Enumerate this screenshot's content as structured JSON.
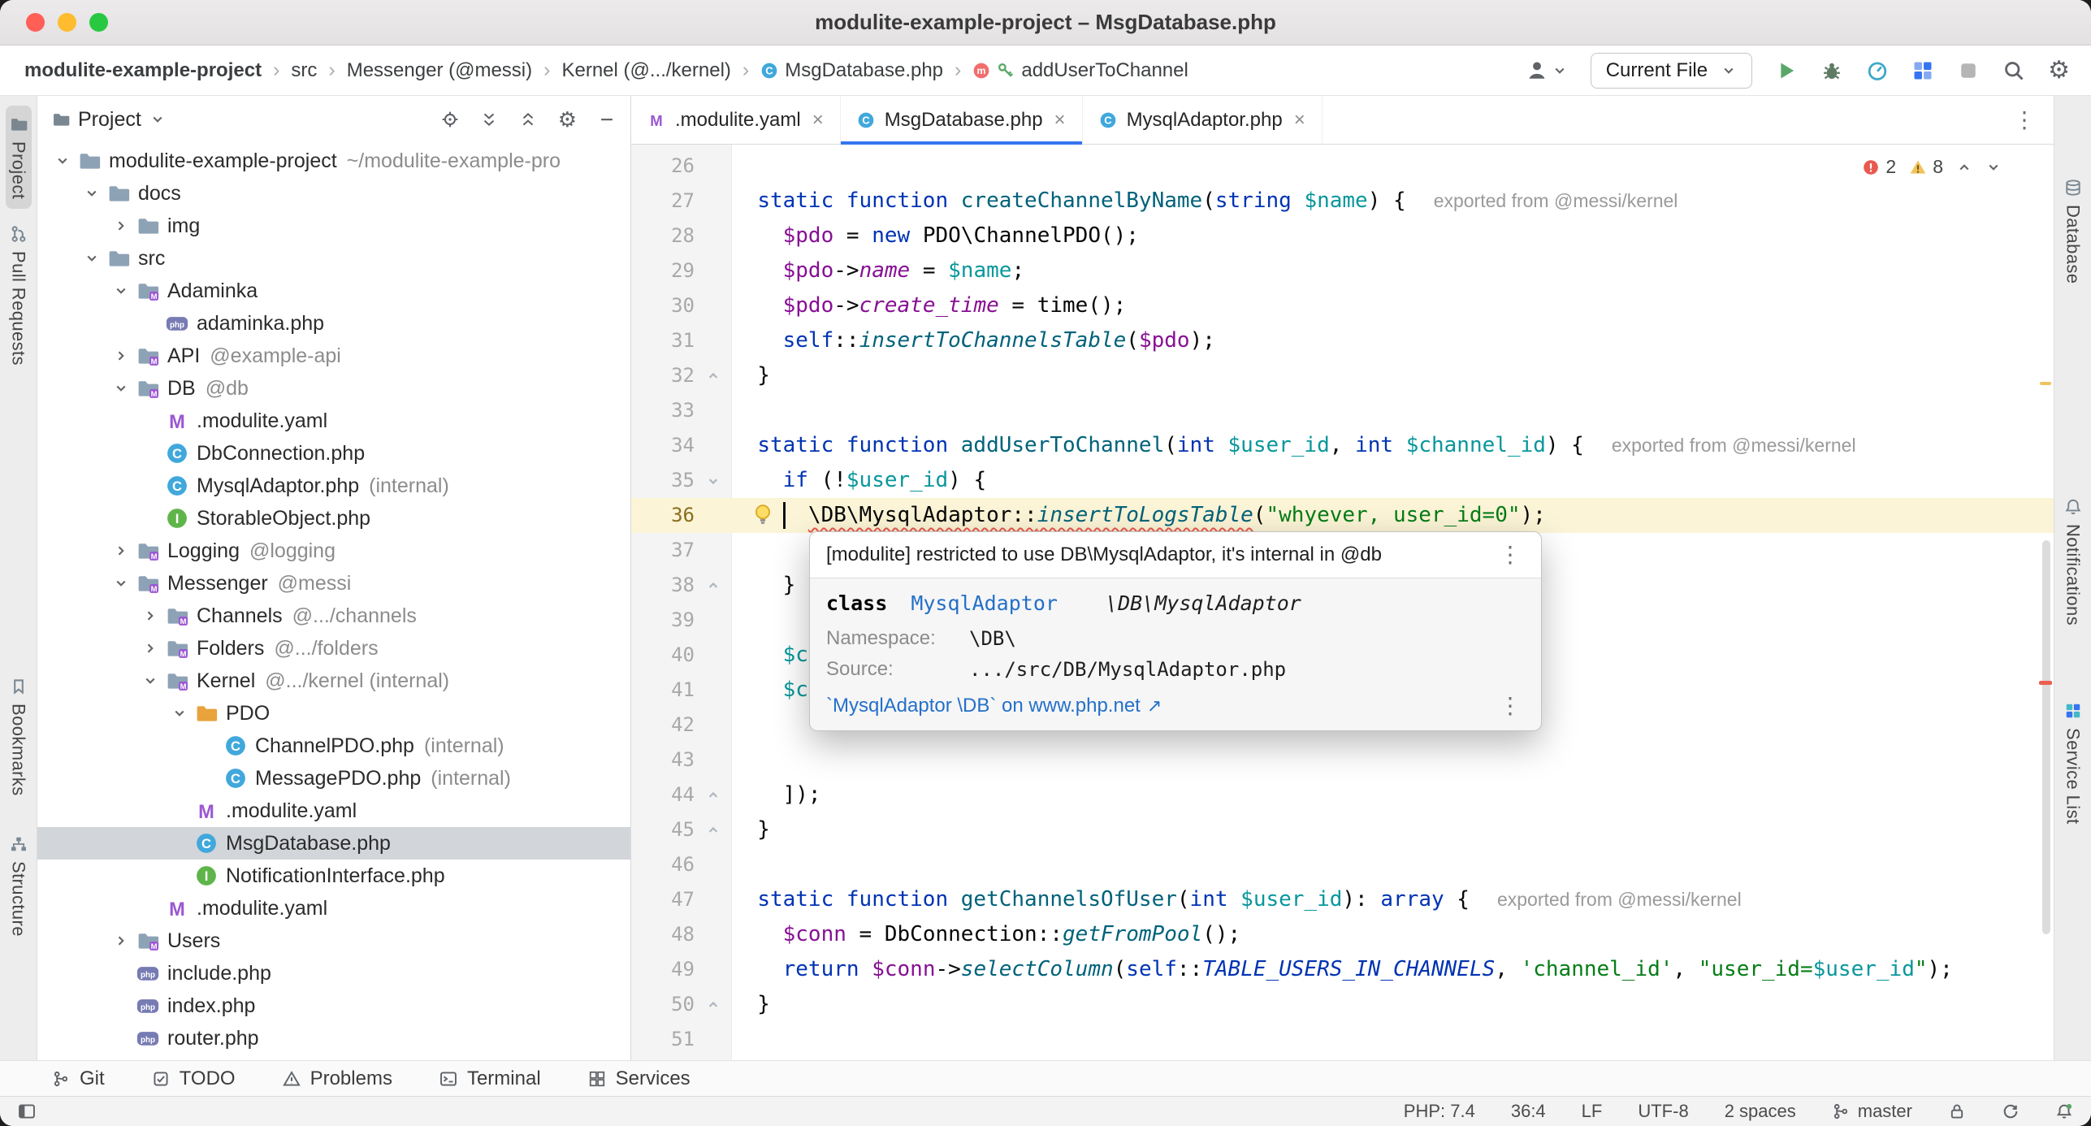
{
  "window": {
    "title": "modulite-example-project – MsgDatabase.php"
  },
  "colors": {
    "accent": "#3574F0",
    "error": "#E8594F",
    "warning": "#F2C35C",
    "keyword": "#0033B3",
    "string": "#067D17",
    "variable": "#871094",
    "parameter": "#08979C",
    "function": "#00627A",
    "selection": "#D2D5D9",
    "line_highlight": "#FCF4D6"
  },
  "navbar": {
    "breadcrumbs": [
      {
        "label": "modulite-example-project",
        "bold": true
      },
      {
        "label": "src"
      },
      {
        "label": "Messenger (@messi)"
      },
      {
        "label": "Kernel (@.../kernel)"
      },
      {
        "label": "MsgDatabase.php",
        "icons": [
          "class"
        ]
      },
      {
        "label": "addUserToChannel",
        "icons": [
          "method",
          "key"
        ]
      }
    ],
    "run_config": "Current File"
  },
  "left_stripe": [
    {
      "label": "Project",
      "icon": "project",
      "active": true,
      "gap": 12
    },
    {
      "label": "Pull Requests",
      "icon": "pull-request",
      "gap": 8
    },
    {
      "label": "Bookmarks",
      "icon": "bookmark",
      "gap": 360
    },
    {
      "label": "Structure",
      "icon": "structure",
      "gap": 24
    }
  ],
  "right_stripe": [
    {
      "label": "Database",
      "icon": "database",
      "gap": 90
    },
    {
      "label": "Notifications",
      "icon": "bell",
      "gap": 240
    },
    {
      "label": "Service List",
      "icon": "service-list",
      "gap": 70
    }
  ],
  "project_panel": {
    "title": "Project",
    "tree": [
      {
        "label": "modulite-example-project",
        "level": 0,
        "icon": "folder",
        "chevron": "open",
        "annotation": "~/modulite-example-pro"
      },
      {
        "label": "docs",
        "level": 1,
        "icon": "folder",
        "chevron": "open"
      },
      {
        "label": "img",
        "level": 2,
        "icon": "folder",
        "chevron": "closed"
      },
      {
        "label": "src",
        "level": 1,
        "icon": "folder",
        "chevron": "open"
      },
      {
        "label": "Adaminka",
        "level": 2,
        "icon": "folder-module",
        "chevron": "open"
      },
      {
        "label": "adaminka.php",
        "level": 3,
        "icon": "php"
      },
      {
        "label": "API",
        "level": 2,
        "icon": "folder-module",
        "chevron": "closed",
        "annotation": "@example-api"
      },
      {
        "label": "DB",
        "level": 2,
        "icon": "folder-module",
        "chevron": "open",
        "annotation": "@db"
      },
      {
        "label": ".modulite.yaml",
        "level": 3,
        "icon": "modulite"
      },
      {
        "label": "DbConnection.php",
        "level": 3,
        "icon": "class"
      },
      {
        "label": "MysqlAdaptor.php",
        "level": 3,
        "icon": "class",
        "annotation": "(internal)"
      },
      {
        "label": "StorableObject.php",
        "level": 3,
        "icon": "interface"
      },
      {
        "label": "Logging",
        "level": 2,
        "icon": "folder-module",
        "chevron": "closed",
        "annotation": "@logging"
      },
      {
        "label": "Messenger",
        "level": 2,
        "icon": "folder-module",
        "chevron": "open",
        "annotation": "@messi"
      },
      {
        "label": "Channels",
        "level": 3,
        "icon": "folder-module",
        "chevron": "closed",
        "annotation": "@.../channels"
      },
      {
        "label": "Folders",
        "level": 3,
        "icon": "folder-module",
        "chevron": "closed",
        "annotation": "@.../folders"
      },
      {
        "label": "Kernel",
        "level": 3,
        "icon": "folder-module",
        "chevron": "open",
        "annotation": "@.../kernel (internal)"
      },
      {
        "label": "PDO",
        "level": 4,
        "icon": "folder-pdo",
        "chevron": "open"
      },
      {
        "label": "ChannelPDO.php",
        "level": 5,
        "icon": "class",
        "annotation": "(internal)"
      },
      {
        "label": "MessagePDO.php",
        "level": 5,
        "icon": "class",
        "annotation": "(internal)"
      },
      {
        "label": ".modulite.yaml",
        "level": 4,
        "icon": "modulite"
      },
      {
        "label": "MsgDatabase.php",
        "level": 4,
        "icon": "class",
        "selected": true
      },
      {
        "label": "NotificationInterface.php",
        "level": 4,
        "icon": "interface"
      },
      {
        "label": ".modulite.yaml",
        "level": 3,
        "icon": "modulite"
      },
      {
        "label": "Users",
        "level": 2,
        "icon": "folder-module",
        "chevron": "closed"
      },
      {
        "label": "include.php",
        "level": 2,
        "icon": "php"
      },
      {
        "label": "index.php",
        "level": 2,
        "icon": "php"
      },
      {
        "label": "router.php",
        "level": 2,
        "icon": "php"
      }
    ]
  },
  "tabs": [
    {
      "label": ".modulite.yaml",
      "icon": "modulite"
    },
    {
      "label": "MsgDatabase.php",
      "icon": "class",
      "active": true
    },
    {
      "label": "MysqlAdaptor.php",
      "icon": "class"
    }
  ],
  "editor": {
    "errors": "2",
    "warnings": "8",
    "lines": [
      {
        "n": 26,
        "t": []
      },
      {
        "n": 27,
        "t": [
          [
            "sp",
            "  "
          ],
          [
            "kw",
            "static"
          ],
          [
            "sp",
            " "
          ],
          [
            "kw",
            "function"
          ],
          [
            "sp",
            " "
          ],
          [
            "fn",
            "createChannelByName"
          ],
          [
            "sp",
            "("
          ],
          [
            "kw",
            "string"
          ],
          [
            "sp",
            " "
          ],
          [
            "param",
            "$name"
          ],
          [
            "sp",
            ") {"
          ]
        ],
        "inlay": "exported from @messi/kernel"
      },
      {
        "n": 28,
        "t": [
          [
            "sp",
            "    "
          ],
          [
            "var",
            "$pdo"
          ],
          [
            "sp",
            " = "
          ],
          [
            "kw",
            "new"
          ],
          [
            "sp",
            " PDO\\ChannelPDO();"
          ]
        ]
      },
      {
        "n": 29,
        "t": [
          [
            "sp",
            "    "
          ],
          [
            "var",
            "$pdo"
          ],
          [
            "sp",
            "->"
          ],
          [
            "field",
            "name"
          ],
          [
            "sp",
            " = "
          ],
          [
            "param",
            "$name"
          ],
          [
            "sp",
            ";"
          ]
        ]
      },
      {
        "n": 30,
        "t": [
          [
            "sp",
            "    "
          ],
          [
            "var",
            "$pdo"
          ],
          [
            "sp",
            "->"
          ],
          [
            "field",
            "create_time"
          ],
          [
            "sp",
            " = time();"
          ]
        ]
      },
      {
        "n": 31,
        "t": [
          [
            "sp",
            "    "
          ],
          [
            "kw",
            "self"
          ],
          [
            "sp",
            "::"
          ],
          [
            "call",
            "insertToChannelsTable"
          ],
          [
            "sp",
            "("
          ],
          [
            "var",
            "$pdo"
          ],
          [
            "sp",
            ");"
          ]
        ]
      },
      {
        "n": 32,
        "t": [
          [
            "sp",
            "  }"
          ]
        ],
        "fold": "up"
      },
      {
        "n": 33,
        "t": []
      },
      {
        "n": 34,
        "t": [
          [
            "sp",
            "  "
          ],
          [
            "kw",
            "static"
          ],
          [
            "sp",
            " "
          ],
          [
            "kw",
            "function"
          ],
          [
            "sp",
            " "
          ],
          [
            "fn",
            "addUserToChannel"
          ],
          [
            "sp",
            "("
          ],
          [
            "kw",
            "int"
          ],
          [
            "sp",
            " "
          ],
          [
            "param",
            "$user_id"
          ],
          [
            "sp",
            ", "
          ],
          [
            "kw",
            "int"
          ],
          [
            "sp",
            " "
          ],
          [
            "param",
            "$channel_id"
          ],
          [
            "sp",
            ") {"
          ]
        ],
        "inlay": "exported from @messi/kernel"
      },
      {
        "n": 35,
        "t": [
          [
            "sp",
            "    "
          ],
          [
            "kw",
            "if"
          ],
          [
            "sp",
            " (!"
          ],
          [
            "param",
            "$user_id"
          ],
          [
            "sp",
            ") {"
          ]
        ],
        "fold": "down"
      },
      {
        "n": 36,
        "t": [
          [
            "sp",
            "      "
          ],
          [
            "errp",
            "\\DB\\MysqlAdaptor::"
          ],
          [
            "errc",
            "insertToLogsTable"
          ],
          [
            "sp",
            "("
          ],
          [
            "str",
            "\"whyever, user_id=0\""
          ],
          [
            "sp",
            ");"
          ]
        ],
        "hl": true,
        "bulb": true,
        "caret": true
      },
      {
        "n": 37,
        "t": []
      },
      {
        "n": 38,
        "t": [
          [
            "sp",
            "    }"
          ]
        ],
        "fold": "up"
      },
      {
        "n": 39,
        "t": []
      },
      {
        "n": 40,
        "t": [
          [
            "sp",
            "    "
          ],
          [
            "param",
            "$channel_id"
          ],
          [
            "sp",
            ","
          ]
        ]
      },
      {
        "n": 41,
        "t": [
          [
            "sp",
            "    "
          ],
          [
            "param",
            "$channel_id"
          ]
        ]
      },
      {
        "n": 42,
        "t": []
      },
      {
        "n": 43,
        "t": []
      },
      {
        "n": 44,
        "t": [
          [
            "sp",
            "    ]);"
          ]
        ],
        "fold": "up"
      },
      {
        "n": 45,
        "t": [
          [
            "sp",
            "  }"
          ]
        ],
        "fold": "up"
      },
      {
        "n": 46,
        "t": []
      },
      {
        "n": 47,
        "t": [
          [
            "sp",
            "  "
          ],
          [
            "kw",
            "static"
          ],
          [
            "sp",
            " "
          ],
          [
            "kw",
            "function"
          ],
          [
            "sp",
            " "
          ],
          [
            "fn",
            "getChannelsOfUser"
          ],
          [
            "sp",
            "("
          ],
          [
            "kw",
            "int"
          ],
          [
            "sp",
            " "
          ],
          [
            "param",
            "$user_id"
          ],
          [
            "sp",
            "): "
          ],
          [
            "kw",
            "array"
          ],
          [
            "sp",
            " {"
          ]
        ],
        "inlay": "exported from @messi/kernel"
      },
      {
        "n": 48,
        "t": [
          [
            "sp",
            "    "
          ],
          [
            "var",
            "$conn"
          ],
          [
            "sp",
            " = DbConnection::"
          ],
          [
            "call",
            "getFromPool"
          ],
          [
            "sp",
            "();"
          ]
        ]
      },
      {
        "n": 49,
        "t": [
          [
            "sp",
            "    "
          ],
          [
            "kw",
            "return"
          ],
          [
            "sp",
            " "
          ],
          [
            "var",
            "$conn"
          ],
          [
            "sp",
            "->"
          ],
          [
            "call",
            "selectColumn"
          ],
          [
            "sp",
            "("
          ],
          [
            "kw",
            "self"
          ],
          [
            "sp",
            "::"
          ],
          [
            "const",
            "TABLE_USERS_IN_CHANNELS"
          ],
          [
            "sp",
            ", "
          ],
          [
            "str",
            "'channel_id'"
          ],
          [
            "sp",
            ", "
          ],
          [
            "str",
            "\"user_id="
          ],
          [
            "param",
            "$user_id"
          ],
          [
            "str",
            "\""
          ],
          [
            "sp",
            ");"
          ]
        ]
      },
      {
        "n": 50,
        "t": [
          [
            "sp",
            "  }"
          ]
        ],
        "fold": "up"
      },
      {
        "n": 51,
        "t": []
      }
    ]
  },
  "popup": {
    "message": "[modulite] restricted to use DB\\MysqlAdaptor, it's internal in @db",
    "class_kw": "class",
    "class_name": "MysqlAdaptor",
    "class_fqn": "\\DB\\MysqlAdaptor",
    "namespace_label": "Namespace:",
    "namespace_value": "\\DB\\",
    "source_label": "Source:",
    "source_value": ".../src/DB/MysqlAdaptor.php",
    "link": "`MysqlAdaptor \\DB` on www.php.net",
    "link_arrow": "↗"
  },
  "bottom_toolbar": [
    {
      "label": "Git",
      "icon": "branch"
    },
    {
      "label": "TODO",
      "icon": "todo"
    },
    {
      "label": "Problems",
      "icon": "problems"
    },
    {
      "label": "Terminal",
      "icon": "terminal"
    },
    {
      "label": "Services",
      "icon": "services"
    }
  ],
  "status_bar": {
    "items": [
      {
        "label": "PHP: 7.4"
      },
      {
        "label": "36:4"
      },
      {
        "label": "LF"
      },
      {
        "label": "UTF-8"
      },
      {
        "label": "2 spaces"
      },
      {
        "label": "master",
        "icon": "branch"
      }
    ],
    "icons": [
      "lock",
      "sync",
      "bell-dot"
    ]
  }
}
